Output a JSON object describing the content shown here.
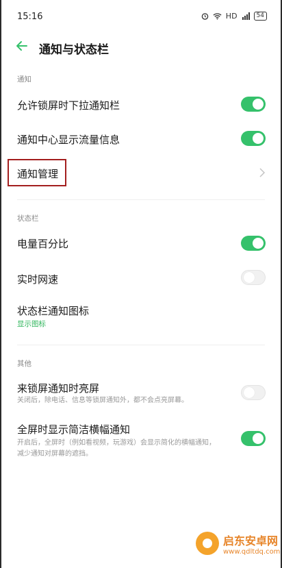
{
  "status_bar": {
    "time": "15:16",
    "icons": [
      "alarm-icon",
      "wifi-icon",
      "hd-label",
      "signal-icon",
      "battery-icon"
    ],
    "hd": "HD",
    "battery": "54"
  },
  "header": {
    "title": "通知与状态栏"
  },
  "sections": {
    "notifications": {
      "label": "通知",
      "lockscreen_pull": {
        "title": "允许锁屏时下拉通知栏",
        "on": true
      },
      "traffic_info": {
        "title": "通知中心显示流量信息",
        "on": true
      },
      "manage": {
        "title": "通知管理"
      }
    },
    "statusbar": {
      "label": "状态栏",
      "battery_pct": {
        "title": "电量百分比",
        "on": true
      },
      "net_speed": {
        "title": "实时网速",
        "on": false
      },
      "notif_icons": {
        "title": "状态栏通知图标",
        "value": "显示图标"
      }
    },
    "other": {
      "label": "其他",
      "wake_screen": {
        "title": "来锁屏通知时亮屏",
        "desc": "关闭后，除电话、信息等锁屏通知外，都不会点亮屏幕。",
        "on": false
      },
      "fullscreen_banner": {
        "title": "全屏时显示简洁横幅通知",
        "desc_line1": "开启后，全屏时（例如看视频，玩游戏）会显示简化的横幅通知，",
        "desc_line2": "减少通知对屏幕的遮挡。",
        "on": true
      }
    }
  },
  "watermark": {
    "name": "启东安卓网",
    "url": "www.qdltdq.com"
  },
  "colors": {
    "accent": "#35c16b",
    "highlight": "#a31e1e",
    "watermark": "#e7852a"
  }
}
